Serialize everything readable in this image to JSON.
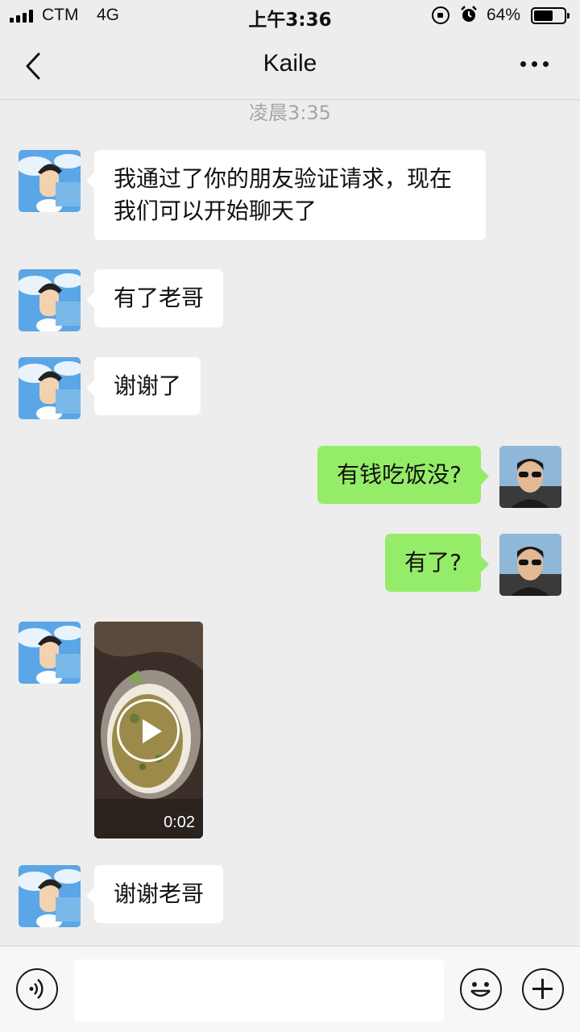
{
  "status_bar": {
    "carrier": "CTM",
    "network": "4G",
    "time": "上午3:36",
    "battery_percent": "64%",
    "battery_level": 0.64,
    "icons": [
      "signal-icon",
      "rotation-lock-icon",
      "alarm-icon",
      "battery-icon"
    ]
  },
  "nav": {
    "title": "Kaile",
    "icons": [
      "back-chevron-icon",
      "more-icon"
    ]
  },
  "chat": {
    "timestamp": "凌晨3:35",
    "messages": [
      {
        "from": "contact",
        "type": "text",
        "text": "我通过了你的朋友验证请求，现在我们可以开始聊天了"
      },
      {
        "from": "contact",
        "type": "text",
        "text": "有了老哥"
      },
      {
        "from": "contact",
        "type": "text",
        "text": "谢谢了"
      },
      {
        "from": "me",
        "type": "text",
        "text": "有钱吃饭没?"
      },
      {
        "from": "me",
        "type": "text",
        "text": "有了?"
      },
      {
        "from": "contact",
        "type": "video",
        "duration": "0:02"
      },
      {
        "from": "contact",
        "type": "text",
        "text": "谢谢老哥"
      }
    ]
  },
  "input_bar": {
    "value": "",
    "icons": [
      "voice-icon",
      "emoji-icon",
      "plus-icon"
    ]
  }
}
